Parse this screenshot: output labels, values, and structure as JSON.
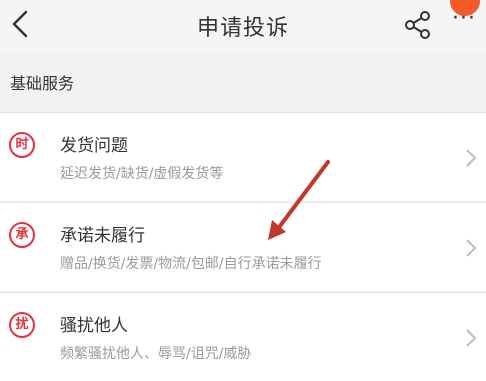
{
  "header": {
    "title": "申请投诉",
    "back_icon": "chevron-left-icon",
    "share_icon": "share-icon",
    "more_icon": "more-dots-icon",
    "badge_color": "#f25c2a"
  },
  "section_title": "基础服务",
  "items": [
    {
      "icon_char": "时",
      "title": "发货问题",
      "subtitle": "延迟发货/缺货/虚假发货等"
    },
    {
      "icon_char": "承",
      "title": "承诺未履行",
      "subtitle": "赠品/换货/发票/物流/包邮/自行承诺未履行"
    },
    {
      "icon_char": "扰",
      "title": "骚扰他人",
      "subtitle": "频繁骚扰他人、辱骂/诅咒/威胁"
    }
  ],
  "colors": {
    "accent_red": "#e8303d",
    "annotation_arrow": "#c0392b"
  }
}
